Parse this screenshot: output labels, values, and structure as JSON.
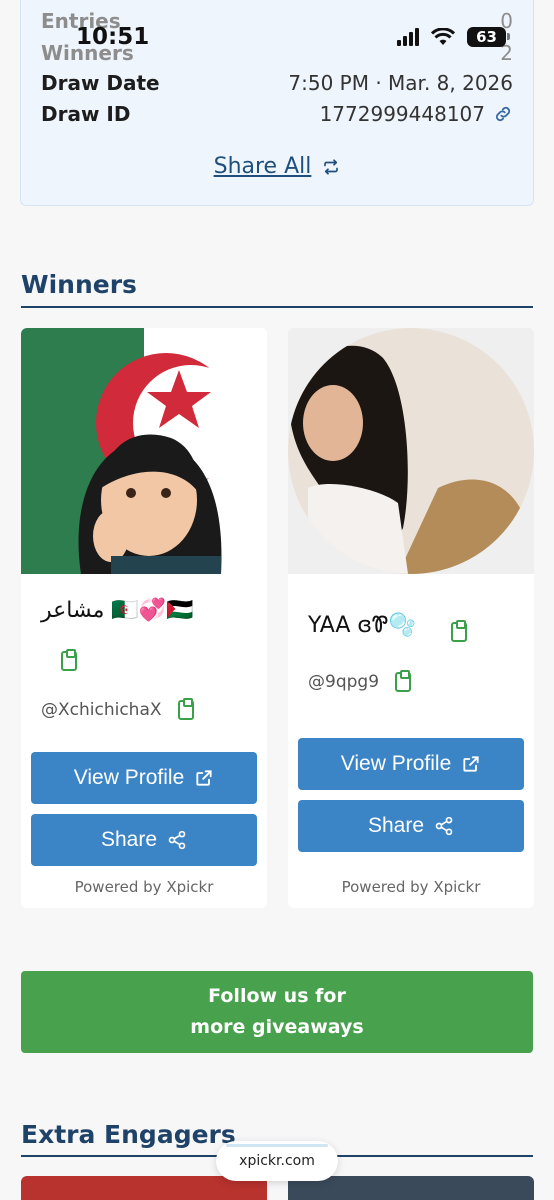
{
  "status_bar": {
    "time": "10:51",
    "battery": "63"
  },
  "summary": {
    "entries_label": "Entries",
    "entries_value": "0",
    "winners_label": "Winners",
    "winners_value": "2",
    "draw_date_label": "Draw Date",
    "draw_date_value": "7:50 PM · Mar. 8, 2026",
    "draw_id_label": "Draw ID",
    "draw_id_value": "1772999448107",
    "share_all": "Share All"
  },
  "winners_section": {
    "title": "Winners"
  },
  "winners": [
    {
      "display_name": "مشاعر 🇩🇿💞🇵🇸",
      "handle": "@XchichichaX",
      "view_profile": "View Profile",
      "share": "Share",
      "powered_by": "Powered by Xpickr"
    },
    {
      "display_name": "YAA ɞᏈ🫧",
      "handle": "@9qpg9",
      "view_profile": "View Profile",
      "share": "Share",
      "powered_by": "Powered by Xpickr"
    }
  ],
  "follow_button": {
    "line1": "Follow us for",
    "line2": "more giveaways"
  },
  "extra_section": {
    "title": "Extra Engagers"
  },
  "footer_pill": {
    "label": "xpickr.com"
  },
  "colors": {
    "accent": "#3b84c6",
    "follow_green": "#48a14c",
    "heading": "#1f4268",
    "clipboard": "#3aa04a"
  },
  "icons": [
    "signal-icon",
    "wifi-icon",
    "battery-icon",
    "link-icon",
    "repeat-icon",
    "clipboard-icon",
    "external-link-icon",
    "share-icon"
  ]
}
